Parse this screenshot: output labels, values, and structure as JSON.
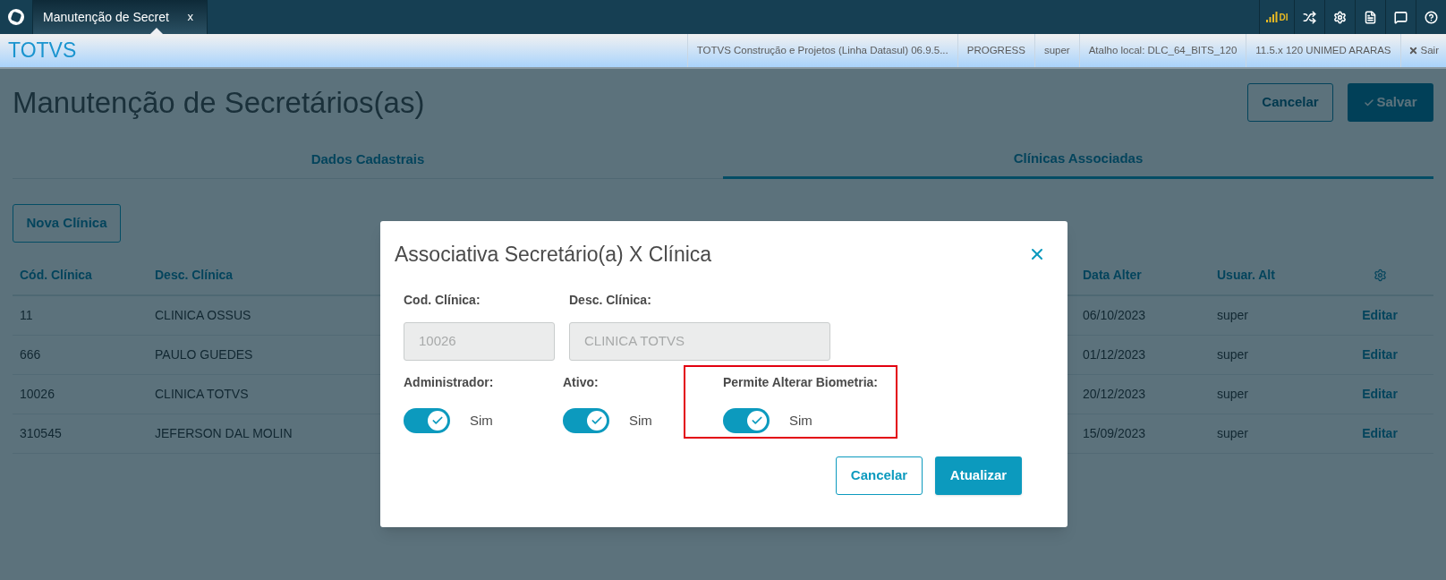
{
  "top_bar": {
    "tab": {
      "title": "Manutenção de Secret",
      "close": "x"
    },
    "signal_label": "DI"
  },
  "header": {
    "brand": "TOTVS",
    "info": [
      "TOTVS Construção e Projetos (Linha Datasul) 06.9.5...",
      "PROGRESS",
      "super",
      "Atalho local: DLC_64_BITS_120",
      "11.5.x 120 UNIMED ARARAS"
    ],
    "logout": "Sair"
  },
  "page": {
    "title": "Manutenção de Secretários(as)",
    "buttons": [
      "Cancelar",
      "Salvar"
    ],
    "tabs": [
      {
        "label": "Dados Cadastrais",
        "selected": false
      },
      {
        "label": "Clínicas Associadas",
        "selected": true
      }
    ],
    "new_button": "Nova Clínica",
    "table": {
      "columns": [
        "Cód. Clínica",
        "Desc. Clínica",
        "Data Alter",
        "Usuar. Alt"
      ],
      "rows": [
        {
          "code": "11",
          "desc": "CLINICA OSSUS",
          "date": "06/10/2023",
          "user": "super",
          "action": "Editar"
        },
        {
          "code": "666",
          "desc": "PAULO GUEDES",
          "date": "01/12/2023",
          "user": "super",
          "action": "Editar"
        },
        {
          "code": "10026",
          "desc": "CLINICA TOTVS",
          "date": "20/12/2023",
          "user": "super",
          "action": "Editar"
        },
        {
          "code": "310545",
          "desc": "JEFERSON DAL MOLIN",
          "date": "15/09/2023",
          "user": "super",
          "action": "Editar"
        }
      ]
    }
  },
  "modal": {
    "title": "Associativa Secretário(a) X Clínica",
    "fields": [
      {
        "label": "Cod. Clínica:",
        "value": "10026"
      },
      {
        "label": "Desc. Clínica:",
        "value": "CLINICA TOTVS"
      }
    ],
    "switches": [
      {
        "label": "Administrador:",
        "on": true,
        "text": "Sim",
        "highlighted": false
      },
      {
        "label": "Ativo:",
        "on": true,
        "text": "Sim",
        "highlighted": false
      },
      {
        "label": "Permite Alterar Biometria:",
        "on": true,
        "text": "Sim",
        "highlighted": true
      }
    ],
    "buttons": [
      "Cancelar",
      "Atualizar"
    ]
  }
}
